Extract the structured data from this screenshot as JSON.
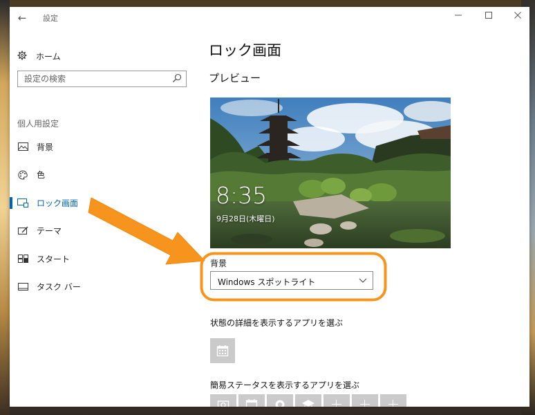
{
  "window": {
    "title": "設定",
    "back_icon": "back-arrow-icon",
    "controls": [
      "minimize-icon",
      "maximize-icon",
      "close-icon"
    ]
  },
  "sidebar": {
    "home_label": "ホーム",
    "home_icon": "gear-icon",
    "search_placeholder": "設定の検索",
    "search_icon": "search-icon",
    "section_label": "個人用設定",
    "items": [
      {
        "label": "背景",
        "icon": "picture-icon",
        "active": false
      },
      {
        "label": "色",
        "icon": "palette-icon",
        "active": false
      },
      {
        "label": "ロック画面",
        "icon": "lock-screen-icon",
        "active": true
      },
      {
        "label": "テーマ",
        "icon": "theme-icon",
        "active": false
      },
      {
        "label": "スタート",
        "icon": "start-icon",
        "active": false
      },
      {
        "label": "タスク バー",
        "icon": "taskbar-icon",
        "active": false
      }
    ]
  },
  "main": {
    "title": "ロック画面",
    "preview_heading": "プレビュー",
    "preview": {
      "time": "8:35",
      "date": "9月28日(木曜日)"
    },
    "background": {
      "label": "背景",
      "selected": "Windows スポットライト"
    },
    "detail_apps_label": "状態の詳細を表示するアプリを選ぶ",
    "quick_apps_label": "簡易ステータスを表示するアプリを選ぶ"
  },
  "colors": {
    "accent": "#0063b1",
    "annotation": "#f7941d",
    "tile": "#cacaca"
  }
}
